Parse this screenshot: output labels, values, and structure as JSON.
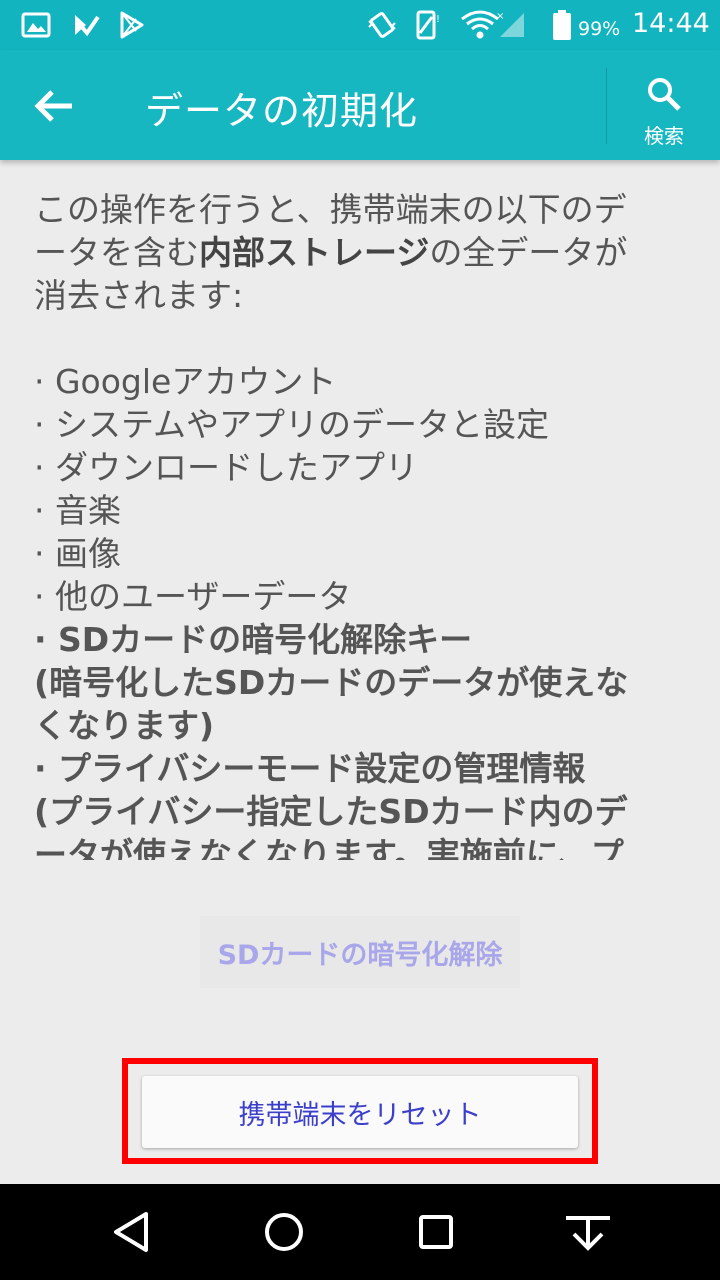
{
  "status_bar": {
    "battery": "99%",
    "time": "14:44",
    "icons": [
      "gallery-icon",
      "download-check-icon",
      "play-store-icon",
      "vibrate-icon",
      "no-sim-icon",
      "wifi-icon",
      "signal-icon",
      "battery-icon"
    ]
  },
  "app_bar": {
    "title": "データの初期化",
    "search_label": "検索",
    "icons": [
      "back-arrow-icon",
      "search-icon"
    ]
  },
  "content": {
    "intro_line1": "この操作を行うと、携帯端末の以下のデ",
    "intro_line2_pre": "ータを含む",
    "intro_line2_bold": "内部ストレージ",
    "intro_line2_post": "の全データが",
    "intro_line3": "消去されます:",
    "items": [
      "· Googleアカウント",
      "· システムやアプリのデータと設定",
      "· ダウンロードしたアプリ",
      "· 音楽",
      "· 画像",
      "· 他のユーザーデータ"
    ],
    "bold_lines": [
      "· SDカードの暗号化解除キー",
      "(暗号化したSDカードのデータが使えな",
      "くなります)",
      "· プライバシーモード設定の管理情報",
      "(プライバシー指定したSDカード内のデ",
      "ータが使えなくなります。実施前に、プ"
    ]
  },
  "buttons": {
    "sd_decrypt": "SDカードの暗号化解除",
    "reset": "携帯端末をリセット"
  },
  "colors": {
    "app_bar": "#17b7c1",
    "highlight": "#ff0000",
    "reset_text": "#3b3fc9",
    "disabled_text": "#a9a7ea"
  },
  "nav_bar": {
    "icons": [
      "back-triangle-icon",
      "home-circle-icon",
      "recents-square-icon",
      "notification-pull-icon"
    ]
  }
}
